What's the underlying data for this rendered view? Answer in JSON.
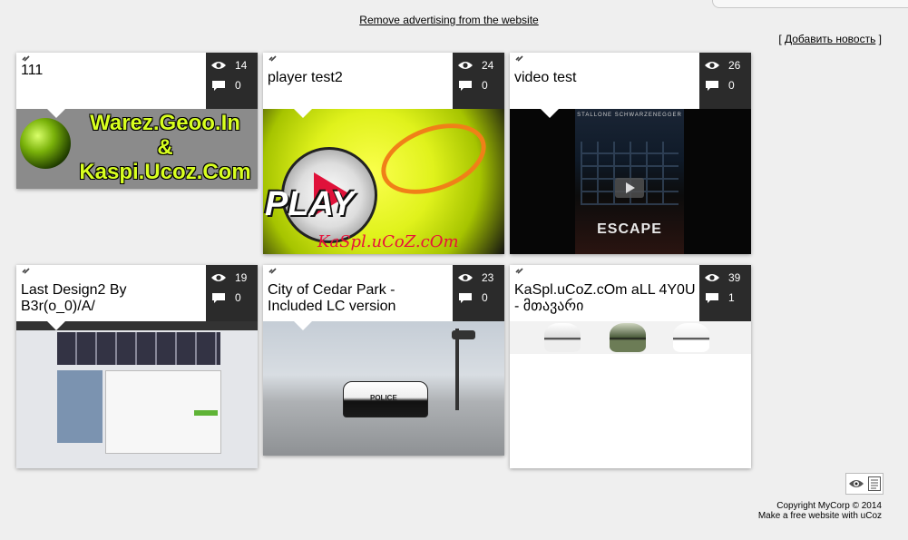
{
  "header": {
    "ad_link": "Remove advertising from the website",
    "add_news_open": "[ ",
    "add_news_label": "Добавить новость",
    "add_news_close": " ]"
  },
  "cards": [
    {
      "title": "111",
      "views": "14",
      "comments": "0",
      "thumb_text": "Warez.Geoo.In\n&\nKaspi.Ucoz.Com"
    },
    {
      "title": "player test2",
      "views": "24",
      "comments": "0",
      "thumb_text": "PLAY",
      "thumb_signature": "KaSpl.uCoZ.cOm"
    },
    {
      "title": "video test",
      "views": "26",
      "comments": "0",
      "thumb_text": "ESCAPE",
      "thumb_top": "STALLONE  SCHWARZENEGGER"
    },
    {
      "title": "Last Design2 By B3r(o_0)/A/",
      "views": "19",
      "comments": "0"
    },
    {
      "title": "City of Cedar Park - Included LC version",
      "views": "23",
      "comments": "0",
      "thumb_text": "POLICE"
    },
    {
      "title": "KaSpl.uCoZ.cOm aLL 4Y0U - მთავარი",
      "views": "39",
      "comments": "1"
    }
  ],
  "footer": {
    "copyright": "Copyright MyCorp © 2014",
    "ucoz": "Make a free website with uCoz"
  },
  "icons": {
    "views": "eye-icon",
    "comments": "comment-icon",
    "link": "link-icon"
  }
}
